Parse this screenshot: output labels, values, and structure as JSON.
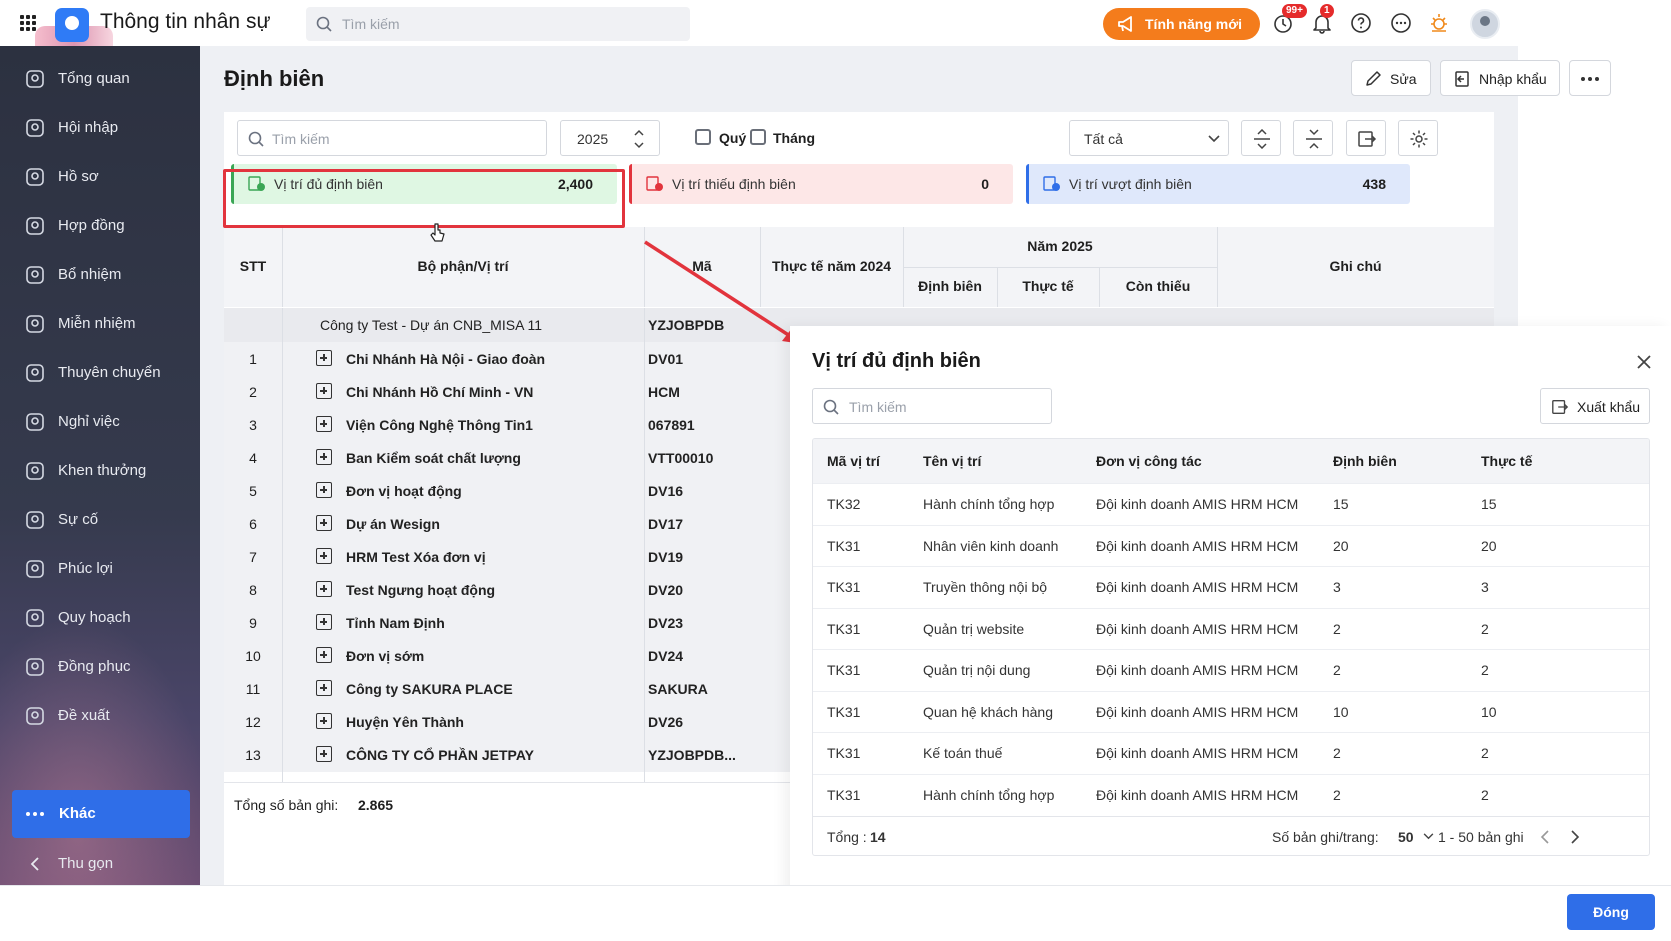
{
  "header": {
    "app_title": "Thông tin nhân sự",
    "search_placeholder": "Tìm kiếm",
    "new_feature_label": "Tính năng mới",
    "history_badge": "99+",
    "notification_badge": "1"
  },
  "sidebar": {
    "items": [
      {
        "label": "Tổng quan",
        "icon": "home-icon"
      },
      {
        "label": "Hội nhập",
        "icon": "people-join-icon"
      },
      {
        "label": "Hồ sơ",
        "icon": "person-icon"
      },
      {
        "label": "Hợp đồng",
        "icon": "contract-icon"
      },
      {
        "label": "Bổ nhiệm",
        "icon": "person-add-icon"
      },
      {
        "label": "Miễn nhiệm",
        "icon": "person-remove-icon"
      },
      {
        "label": "Thuyên chuyển",
        "icon": "transfer-icon"
      },
      {
        "label": "Nghỉ việc",
        "icon": "person-x-icon"
      },
      {
        "label": "Khen thưởng",
        "icon": "award-icon"
      },
      {
        "label": "Sự cố",
        "icon": "shield-icon"
      },
      {
        "label": "Phúc lợi",
        "icon": "benefit-icon"
      },
      {
        "label": "Quy hoạch",
        "icon": "planning-icon"
      },
      {
        "label": "Đồng phục",
        "icon": "uniform-icon"
      },
      {
        "label": "Đề xuất",
        "icon": "proposal-icon"
      }
    ],
    "active_item": "Khác",
    "collapse_label": "Thu gọn"
  },
  "main": {
    "title": "Định biên",
    "edit_label": "Sửa",
    "import_label": "Nhập khẩu",
    "filter": {
      "search_placeholder": "Tìm kiếm",
      "year": "2025",
      "quarter_label": "Quý",
      "month_label": "Tháng",
      "scope_select": "Tất cả"
    },
    "summary": [
      {
        "label": "Vị trí đủ định biên",
        "value": "2,400",
        "color": "#dff7e3",
        "accent": "#3aa655"
      },
      {
        "label": "Vị trí thiếu định biên",
        "value": "0",
        "color": "#fde7e7",
        "accent": "#e2343d"
      },
      {
        "label": "Vị trí vượt định biên",
        "value": "438",
        "color": "#dfe8fb",
        "accent": "#2f6ee8"
      }
    ],
    "table": {
      "headers": {
        "stt": "STT",
        "department": "Bộ phận/Vị trí",
        "code": "Mã",
        "actual_prev": "Thực tế năm 2024",
        "year_group": "Năm 2025",
        "quota": "Định biên",
        "actual": "Thực tế",
        "missing": "Còn thiếu",
        "note": "Ghi chú"
      },
      "org_row": {
        "name": "Công ty Test - Dự án CNB_MISA 11",
        "code": "YZJOBPDB"
      },
      "rows": [
        {
          "stt": "1",
          "name": "Chi Nhánh Hà Nội - Giao đoàn",
          "code": "DV01"
        },
        {
          "stt": "2",
          "name": "Chi Nhánh Hồ Chí Minh - VN",
          "code": "HCM"
        },
        {
          "stt": "3",
          "name": "Viện Công Nghệ Thông Tin1",
          "code": "067891"
        },
        {
          "stt": "4",
          "name": "Ban Kiểm soát chất lượng",
          "code": "VTT00010"
        },
        {
          "stt": "5",
          "name": "Đơn vị hoạt động",
          "code": "DV16"
        },
        {
          "stt": "6",
          "name": "Dự án Wesign",
          "code": "DV17"
        },
        {
          "stt": "7",
          "name": "HRM Test Xóa đơn vị",
          "code": "DV19"
        },
        {
          "stt": "8",
          "name": "Test Ngưng hoạt động",
          "code": "DV20"
        },
        {
          "stt": "9",
          "name": "Tỉnh Nam Định",
          "code": "DV23"
        },
        {
          "stt": "10",
          "name": "Đơn vị sớm",
          "code": "DV24"
        },
        {
          "stt": "11",
          "name": "Công ty SAKURA PLACE",
          "code": "SAKURA"
        },
        {
          "stt": "12",
          "name": "Huyện Yên Thành",
          "code": "DV26"
        },
        {
          "stt": "13",
          "name": "CÔNG TY CỔ PHẦN JETPAY",
          "code": "YZJOBPDB..."
        }
      ],
      "total_label": "Tổng số bản ghi:",
      "total_value": "2.865"
    }
  },
  "drawer": {
    "title": "Vị trí đủ định biên",
    "search_placeholder": "Tìm kiếm",
    "export_label": "Xuất khẩu",
    "headers": [
      "Mã vị trí",
      "Tên vị trí",
      "Đơn vị công tác",
      "Định biên",
      "Thực tế"
    ],
    "rows": [
      [
        "TK32",
        "Hành chính tổng hợp",
        "Đội kinh doanh AMIS HRM HCM",
        "15",
        "15"
      ],
      [
        "TK31",
        "Nhân viên kinh doanh",
        "Đội kinh doanh AMIS HRM HCM",
        "20",
        "20"
      ],
      [
        "TK31",
        "Truyền thông nội bộ",
        "Đội kinh doanh AMIS HRM HCM",
        "3",
        "3"
      ],
      [
        "TK31",
        "Quản trị website",
        "Đội kinh doanh AMIS HRM HCM",
        "2",
        "2"
      ],
      [
        "TK31",
        "Quản trị nội dung",
        "Đội kinh doanh AMIS HRM HCM",
        "2",
        "2"
      ],
      [
        "TK31",
        "Quan hệ khách hàng",
        "Đội kinh doanh AMIS HRM HCM",
        "10",
        "10"
      ],
      [
        "TK31",
        "Kế toán thuế",
        "Đội kinh doanh AMIS HRM HCM",
        "2",
        "2"
      ],
      [
        "TK31",
        "Hành chính tổng hợp",
        "Đội kinh doanh AMIS HRM HCM",
        "2",
        "2"
      ]
    ],
    "footer": {
      "total_label": "Tổng :",
      "total_value": "14",
      "page_size_label": "Số bản ghi/trang:",
      "page_size": "50",
      "range": "1 - 50 bản ghi"
    },
    "close_button": "Đóng"
  }
}
